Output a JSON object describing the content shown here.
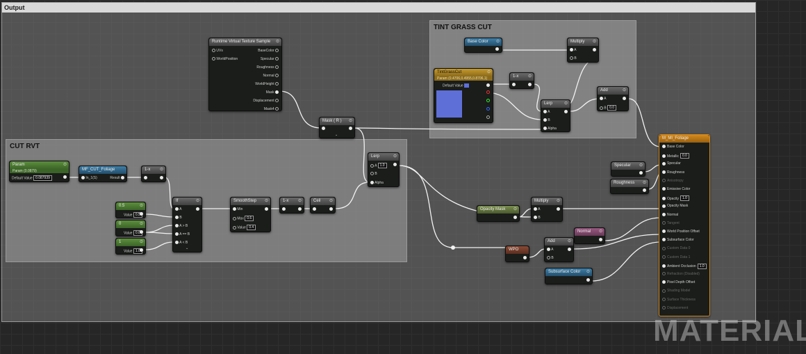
{
  "comments": {
    "output": "Output",
    "tint": "TINT GRASS CUT",
    "cut": "CUT RVT"
  },
  "nodes": {
    "rvt": {
      "title": "Runtime Virtual Texture Sample",
      "inputs": [
        "UVs",
        "WorldPosition"
      ],
      "outputs": [
        "BaseColor",
        "Specular",
        "Roughness",
        "Normal",
        "WorldHeight",
        "Mask",
        "Displacement",
        "Mask4"
      ]
    },
    "mask": {
      "title": "Mask ( R )"
    },
    "base_color": {
      "title": "Base Color"
    },
    "multiply_top": {
      "title": "Multiply",
      "pins": [
        "A",
        "B"
      ]
    },
    "tint": {
      "title": "TintGrassCut",
      "subtitle": "Param (0.4706,0.4955,0.8706,1)",
      "default_label": "Default Value"
    },
    "one_minus_top": {
      "title": "1-x"
    },
    "lerp_top": {
      "title": "Lerp",
      "pins": [
        "A",
        "B",
        "Alpha"
      ]
    },
    "add_top": {
      "title": "Add",
      "pins": [
        "A",
        "B"
      ],
      "b_value": "0.0"
    },
    "param": {
      "title": "Param",
      "subtitle": "Param (0.0879)",
      "default_label": "Default Value",
      "default_value": "0.087939"
    },
    "mf": {
      "title": "MF_CUT_Foliage",
      "input": "In_1(S)",
      "output": "Result"
    },
    "one_minus_a": {
      "title": "1-x"
    },
    "if": {
      "title": "If",
      "pins": [
        "A",
        "B",
        "A > B",
        "A == B",
        "A < B"
      ]
    },
    "c05": {
      "title": "0.5",
      "label": "Value",
      "value": "0.5"
    },
    "c0": {
      "title": "0",
      "label": "Value",
      "value": "0.0"
    },
    "c1": {
      "title": "1",
      "label": "Value",
      "value": "1.0"
    },
    "smooth": {
      "title": "SmoothStep",
      "pins": [
        "Min",
        "Max",
        "Value"
      ],
      "max": "0.6",
      "value": "0.4"
    },
    "one_minus_b": {
      "title": "1-x"
    },
    "ceil": {
      "title": "Ceil"
    },
    "lerp_mid": {
      "title": "Lerp",
      "pins": [
        "A",
        "B",
        "Alpha"
      ],
      "a_value": "1.0"
    },
    "opacity_mask": {
      "title": "Opacity Mask"
    },
    "multiply_bot": {
      "title": "Multiply",
      "pins": [
        "A",
        "B"
      ]
    },
    "specular": {
      "title": "Specular"
    },
    "roughness": {
      "title": "Roughness"
    },
    "normal": {
      "title": "Normal"
    },
    "wpo": {
      "title": "WPO"
    },
    "add_bot": {
      "title": "Add",
      "pins": [
        "A",
        "B"
      ]
    },
    "subsurface": {
      "title": "Subsurface Color"
    },
    "material": {
      "title": "M_MI_Foliage",
      "pins": [
        {
          "label": "Base Color",
          "active": true
        },
        {
          "label": "Metallic",
          "active": true,
          "value": "0.0"
        },
        {
          "label": "Specular",
          "active": true
        },
        {
          "label": "Roughness",
          "active": true
        },
        {
          "label": "Anisotropy",
          "active": false
        },
        {
          "label": "Emissive Color",
          "active": true
        },
        {
          "label": "Opacity",
          "active": true,
          "value": "1.0"
        },
        {
          "label": "Opacity Mask",
          "active": true
        },
        {
          "label": "Normal",
          "active": true
        },
        {
          "label": "Tangent",
          "active": false
        },
        {
          "label": "World Position Offset",
          "active": true
        },
        {
          "label": "Subsurface Color",
          "active": true
        },
        {
          "label": "Custom Data 0",
          "active": false
        },
        {
          "label": "Custom Data 1",
          "active": false
        },
        {
          "label": "Ambient Occlusion",
          "active": true,
          "value": "1.0"
        },
        {
          "label": "Refraction (Disabled)",
          "active": false
        },
        {
          "label": "Pixel Depth Offset",
          "active": true
        },
        {
          "label": "Shading Model",
          "active": false
        },
        {
          "label": "Surface Thickness",
          "active": false
        },
        {
          "label": "Displacement",
          "active": false
        }
      ]
    }
  },
  "watermark": "MATERIAL",
  "colors": {
    "tint_swatch": "#5f6fd8",
    "wire": "#f2f2f2"
  }
}
